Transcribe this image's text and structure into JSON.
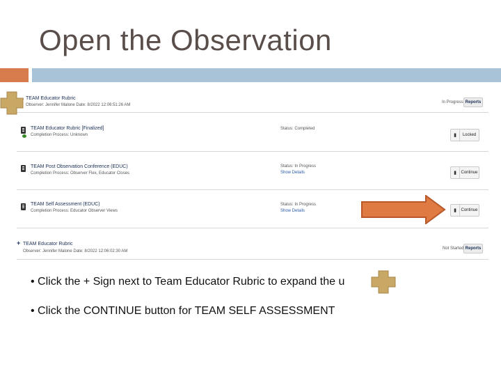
{
  "slide": {
    "title": "Open the Observation",
    "colors": {
      "accent_orange": "#d87b4d",
      "accent_blue": "#a8c3d8",
      "title_color": "#5a4e4b",
      "highlight": "#c9a866",
      "arrow": "#e07a43"
    }
  },
  "screenshot": {
    "header_group": {
      "title": "TEAM Educator Rubric",
      "meta": "Observer: Jennifer Malone  Date: 8/2022 12:06:51:26 AM",
      "status": "In Progress",
      "button": "Reports"
    },
    "rows": [
      {
        "title": "TEAM Educator Rubric [Finalized]",
        "sub": "Completion Process: Unknown",
        "status_line1": "Status: Completed",
        "status_line2": "",
        "button": "Locked",
        "icon": "locked-document-icon"
      },
      {
        "title": "TEAM Post Observation Conference (EDUC)",
        "sub": "Completion Process: Observer Flex, Educator Closes",
        "status_line1": "Status: In Progress",
        "status_line2": "Show Details",
        "button": "Continue",
        "icon": "document-icon"
      },
      {
        "title": "TEAM Self Assessment (EDUC)",
        "sub": "Completion Process: Educator Observer Views",
        "status_line1": "Status: In Progress",
        "status_line2": "Show Details",
        "button": "Continue",
        "icon": "document-icon"
      }
    ],
    "footer_group": {
      "plus": "+",
      "title": "TEAM Educator Rubric",
      "meta": "Observer: Jennifer Malone  Date: 8/2022 12:06:02:30 AM",
      "status": "Not Started",
      "button": "Reports"
    }
  },
  "instructions": [
    "• Click the + Sign next to Team Educator Rubric to expand the      u",
    "• Click the CONTINUE button for TEAM SELF ASSESSMENT"
  ]
}
